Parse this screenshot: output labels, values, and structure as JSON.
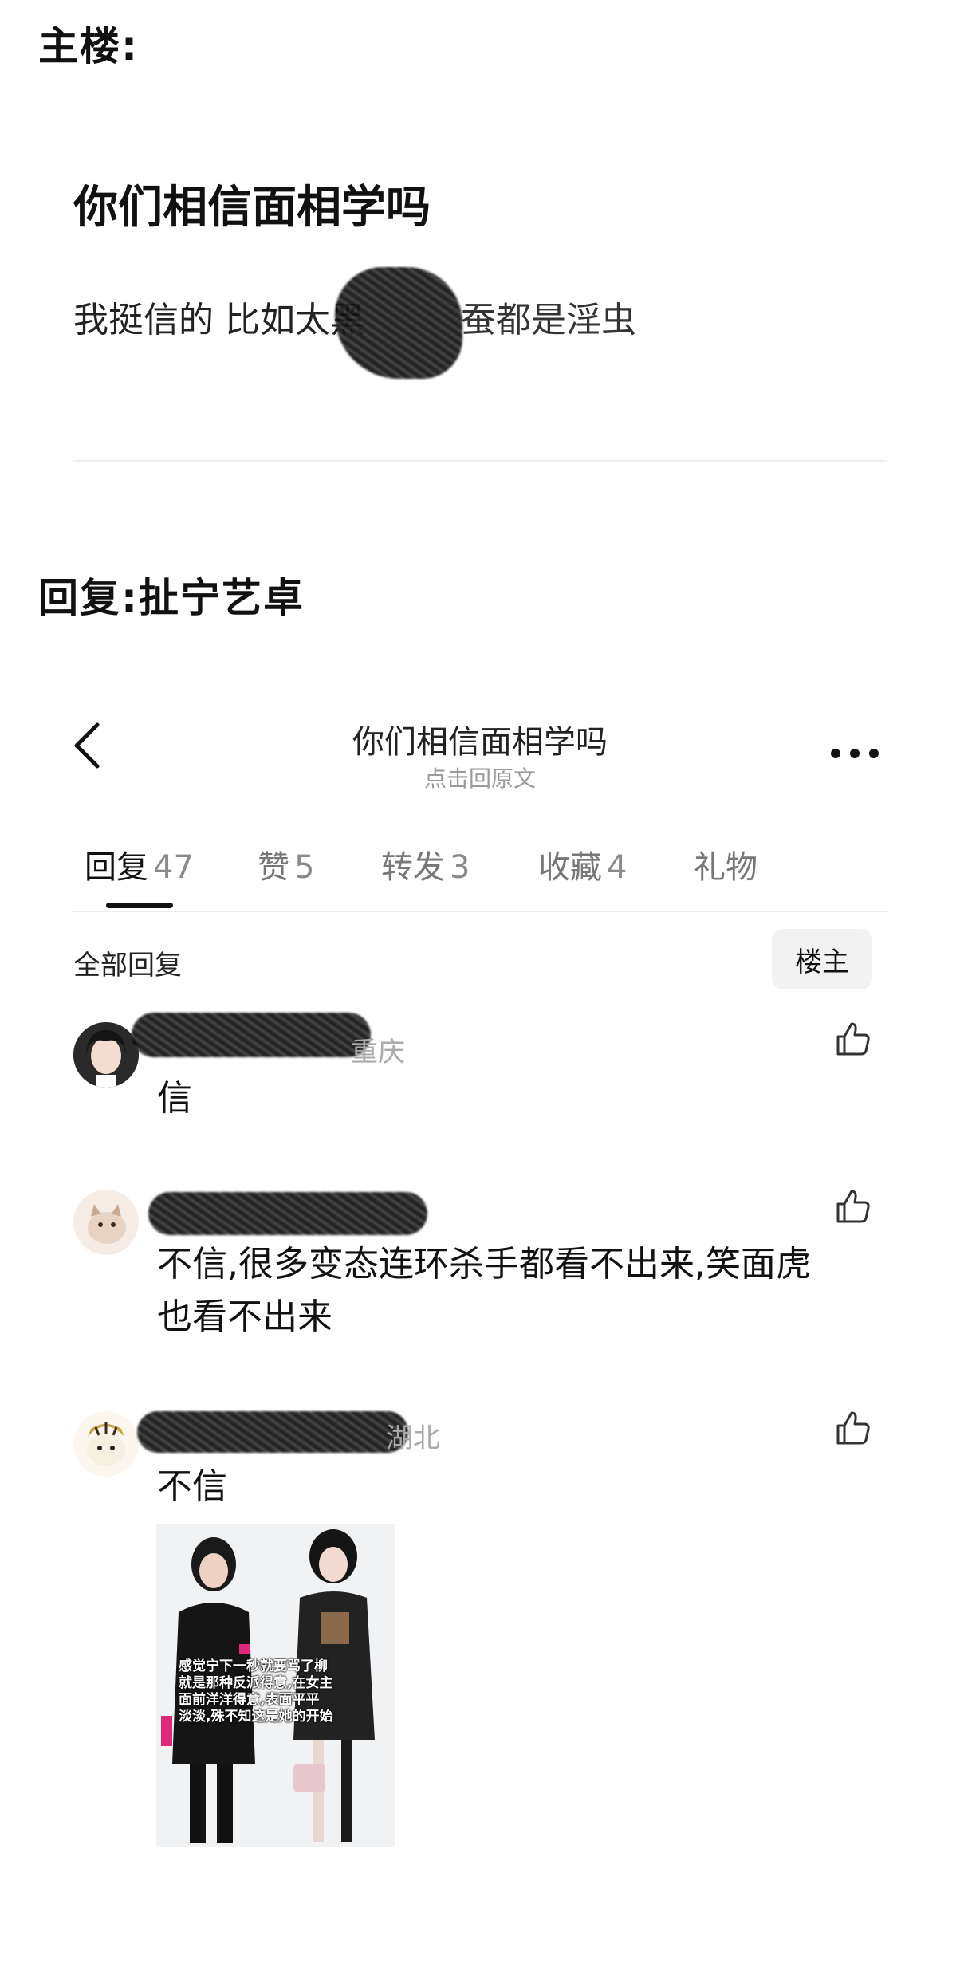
{
  "main_post_label": "主楼:",
  "post": {
    "title": "你们相信面相学吗",
    "body_prefix": "我挺信的 比如太黑",
    "body_suffix": "蚕都是淫虫"
  },
  "reply_label": "回复:扯宁艺卓",
  "nav": {
    "title": "你们相信面相学吗",
    "subtitle": "点击回原文"
  },
  "tabs": [
    {
      "label": "回复",
      "count": "47"
    },
    {
      "label": "赞",
      "count": "5"
    },
    {
      "label": "转发",
      "count": "3"
    },
    {
      "label": "收藏",
      "count": "4"
    },
    {
      "label": "礼物",
      "count": ""
    }
  ],
  "filter": {
    "all_replies": "全部回复",
    "owner_only": "楼主"
  },
  "comments": [
    {
      "location": "重庆",
      "text": "信"
    },
    {
      "location": "",
      "text_line1": "不信,很多变态连环杀手都看不出来,笑面虎",
      "text_line2": "也看不出来"
    },
    {
      "location": "湖北",
      "text": "不信"
    }
  ],
  "image_caption": {
    "line1": "感觉宁下一秒就要骂了柳",
    "line2": "就是那种反派得意,在女主",
    "line3": "面前洋洋得意,表面平平",
    "line4": "淡淡,殊不知这是她的开始"
  },
  "colors": {
    "accent_underline": "#111111",
    "muted_text": "#8a8a8a",
    "divider": "#ececec"
  }
}
